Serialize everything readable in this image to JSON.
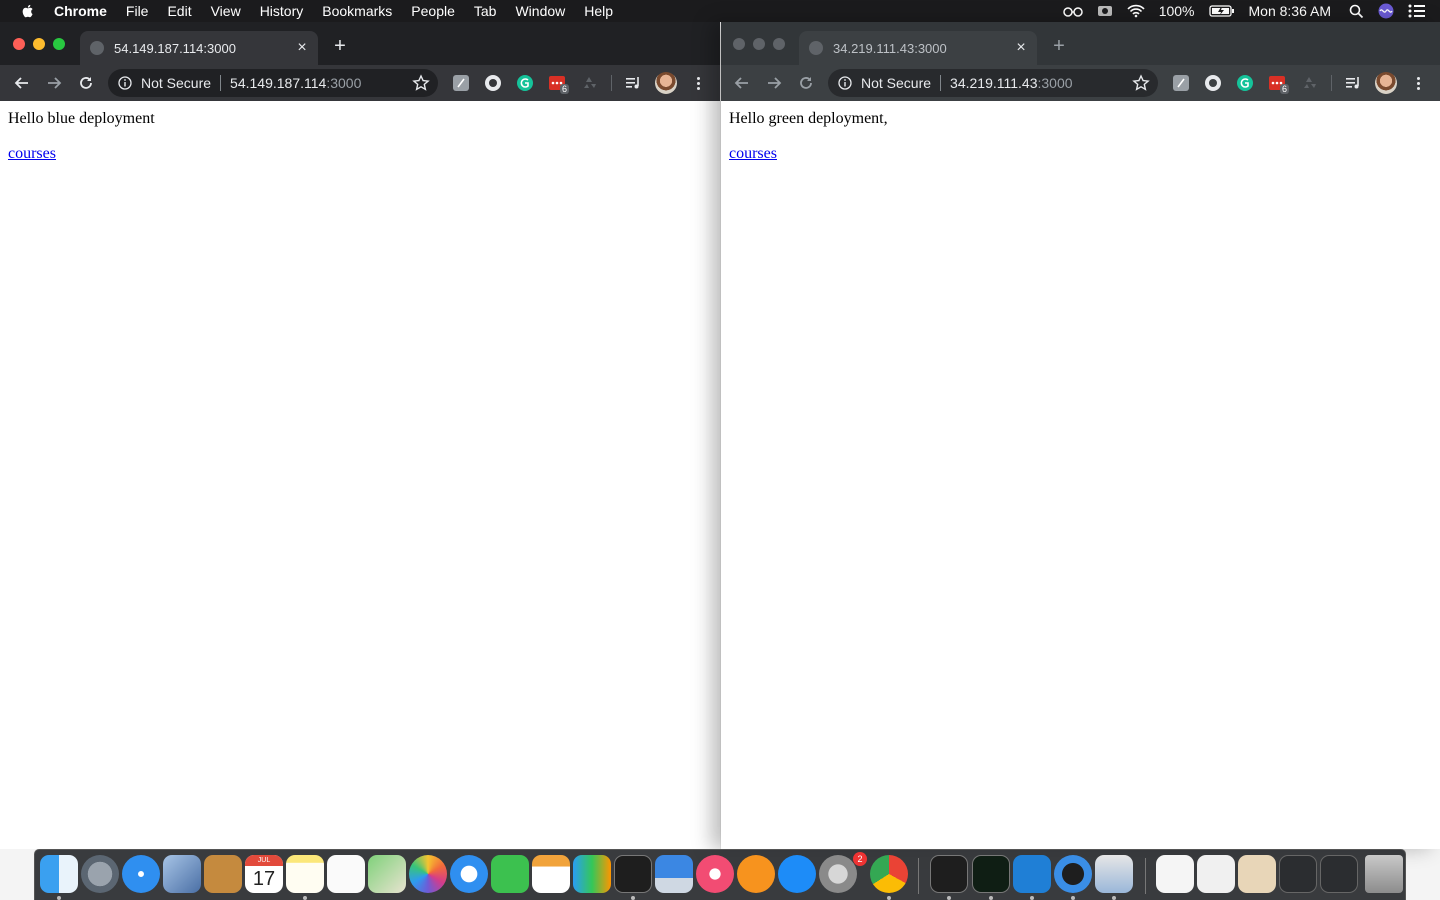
{
  "menubar": {
    "app_name": "Chrome",
    "items": [
      "File",
      "Edit",
      "View",
      "History",
      "Bookmarks",
      "People",
      "Tab",
      "Window",
      "Help"
    ],
    "battery": "100%",
    "clock": "Mon 8:36 AM"
  },
  "windows": {
    "left": {
      "tab_title": "54.149.187.114:3000",
      "security_label": "Not Secure",
      "url_host": "54.149.187.114",
      "url_port": ":3000",
      "extension_badge": "6",
      "heading_text": "Hello blue deployment",
      "link_text": "courses"
    },
    "right": {
      "tab_title": "34.219.111.43:3000",
      "security_label": "Not Secure",
      "url_host": "34.219.111.43",
      "url_port": ":3000",
      "extension_badge": "6",
      "heading_text": "Hello green deployment,",
      "link_text": "courses"
    }
  },
  "dock": {
    "calendar_month": "JUL",
    "calendar_day": "17",
    "system_preferences_badge": "2"
  },
  "colors": {
    "menubar_bg": "#1b1b1d",
    "tabstrip_bg": "#202124",
    "link": "#0000ee",
    "close_red": "#fe5f57",
    "minimize_yellow": "#febc2e",
    "zoom_green": "#28c840"
  }
}
